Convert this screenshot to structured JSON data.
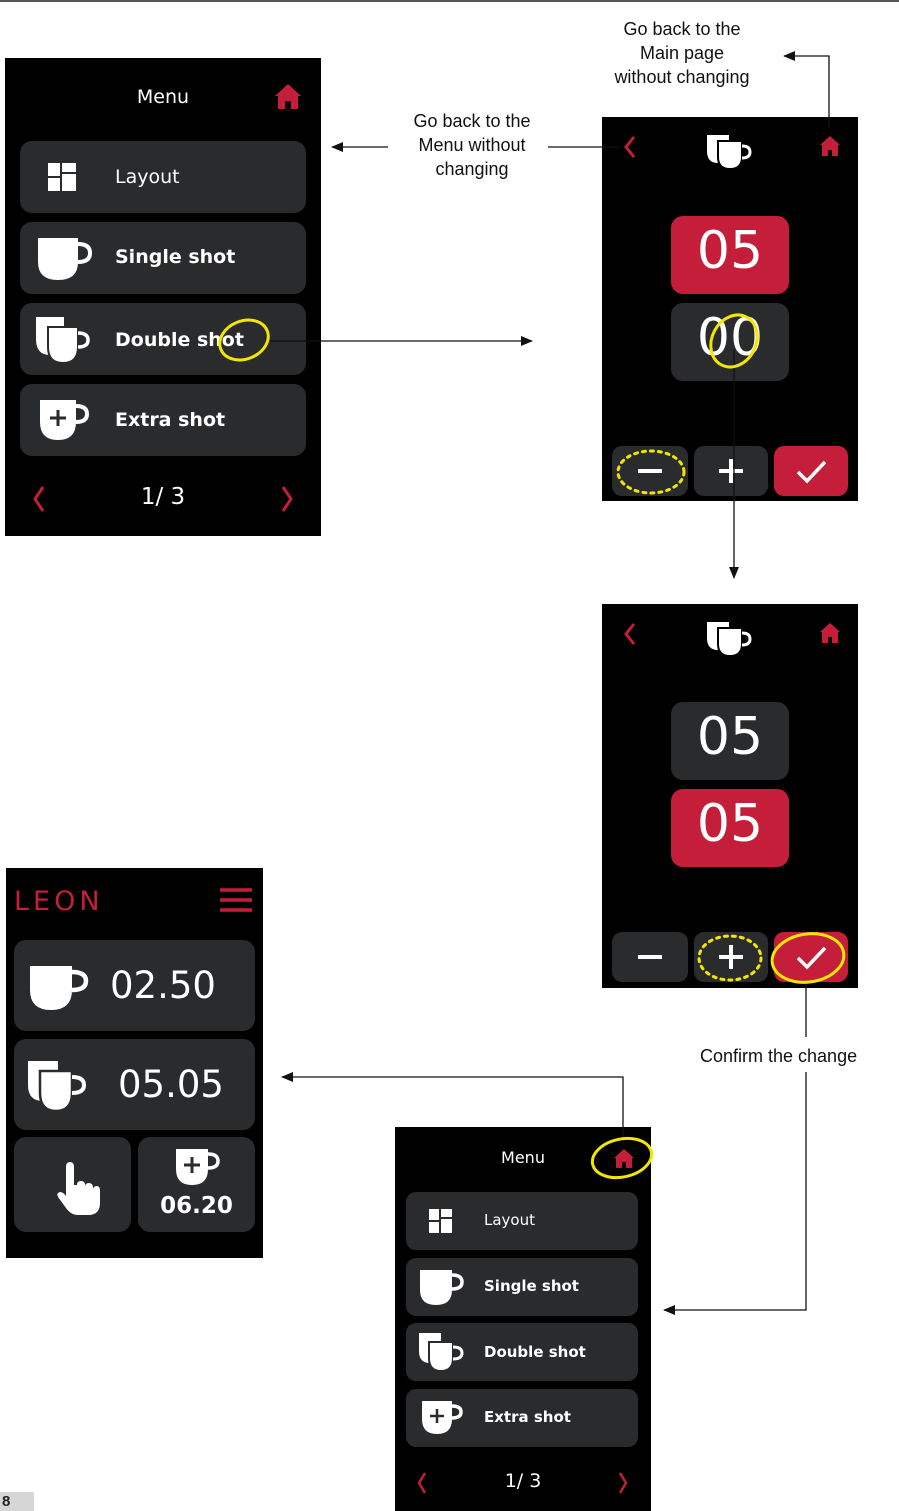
{
  "colors": {
    "accent": "#c41e3a",
    "button": "#2a2b2d",
    "highlight": "#f3e600",
    "screen_bg": "#000000"
  },
  "menu_screen": {
    "title": "Menu",
    "items": [
      {
        "label": "Layout",
        "icon": "layout-grid-icon"
      },
      {
        "label": "Single shot",
        "icon": "single-cup-icon"
      },
      {
        "label": "Double shot",
        "icon": "double-cup-icon"
      },
      {
        "label": "Extra shot",
        "icon": "extra-cup-icon"
      }
    ],
    "pagination": "1/ 3",
    "home_icon": "home-icon",
    "prev_icon": "chevron-left-icon",
    "next_icon": "chevron-right-icon"
  },
  "edit_screen_1": {
    "top_value": "05",
    "bottom_value": "00",
    "selected": "top"
  },
  "edit_screen_2": {
    "top_value": "05",
    "bottom_value": "05",
    "selected": "bottom"
  },
  "main_screen": {
    "brand": "LEON",
    "single_value": "02.50",
    "double_value": "05.05",
    "extra_value": "06.20",
    "manual_icon": "hand-pointer-icon",
    "menu_icon": "hamburger-icon"
  },
  "annotations": {
    "back_main": "Go back to the\nMain page\nwithout changing",
    "back_menu": "Go back to the\nMenu without\nchanging",
    "confirm": "Confirm the change"
  },
  "page_number": "8"
}
